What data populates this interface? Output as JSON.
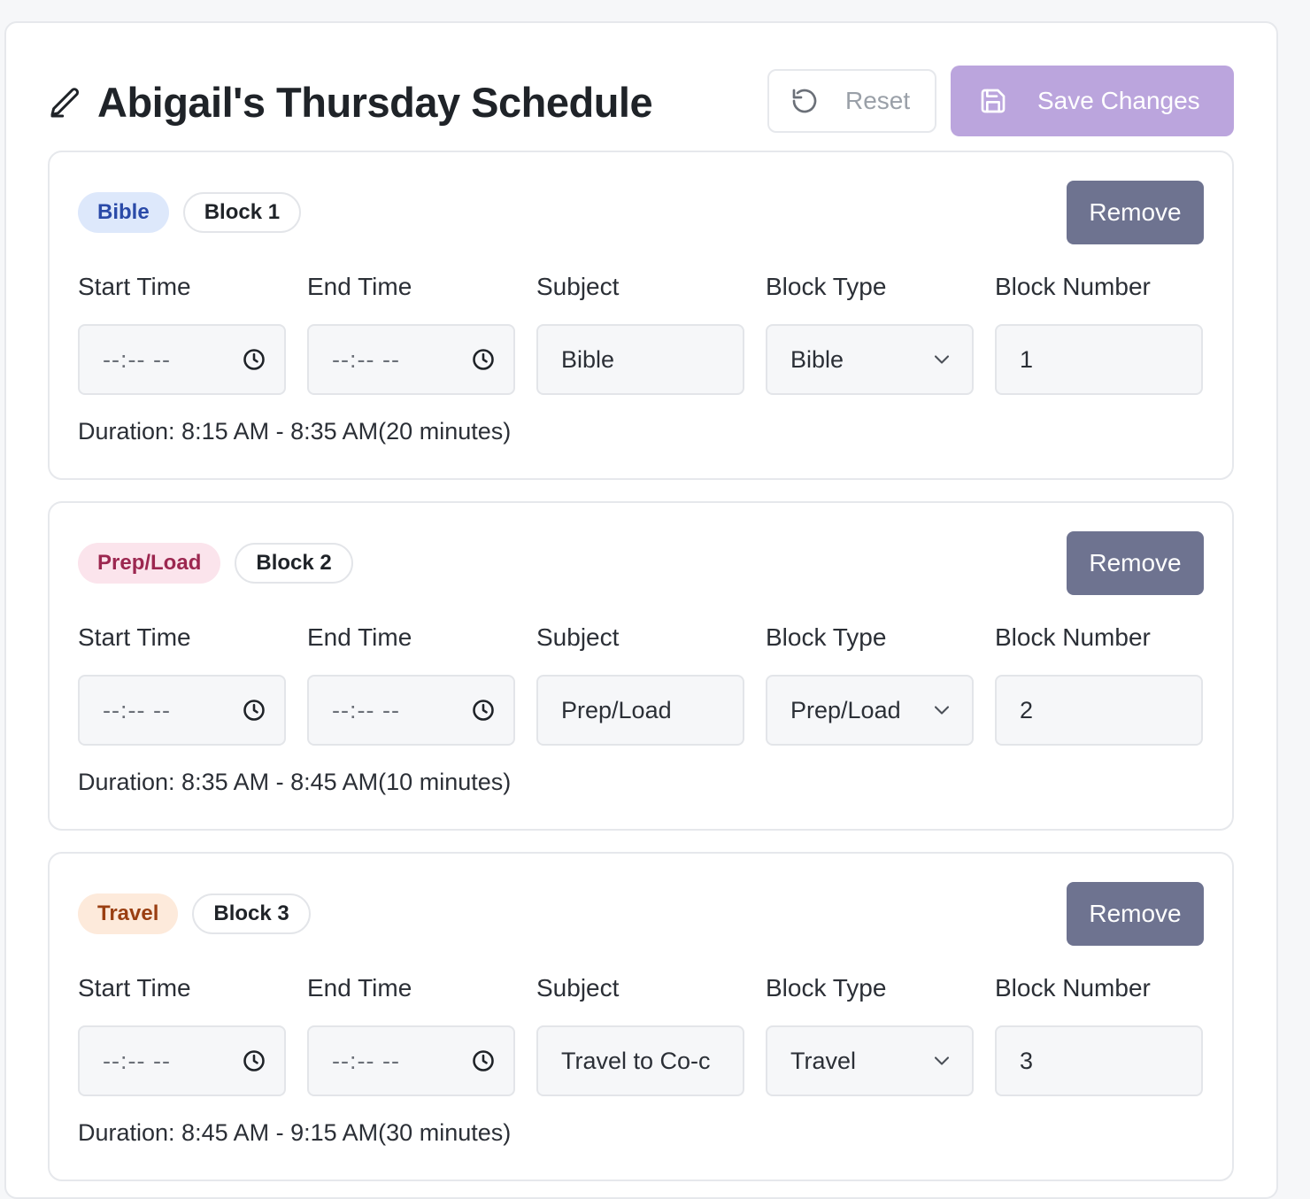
{
  "header": {
    "title": "Abigail's Thursday Schedule",
    "reset_label": "Reset",
    "save_label": "Save Changes"
  },
  "labels": {
    "start_time": "Start Time",
    "end_time": "End Time",
    "subject": "Subject",
    "block_type": "Block Type",
    "block_number": "Block Number",
    "remove": "Remove"
  },
  "blocks": [
    {
      "type_badge": "Bible",
      "block_badge": "Block 1",
      "start_time": "--:-- --",
      "end_time": "--:-- --",
      "subject": "Bible",
      "block_type": "Bible",
      "block_number": "1",
      "duration": "Duration: 8:15 AM - 8:35 AM(20 minutes)",
      "badge_bg": "#dde8fb",
      "badge_fg": "#2a4aa8"
    },
    {
      "type_badge": "Prep/Load",
      "block_badge": "Block 2",
      "start_time": "--:-- --",
      "end_time": "--:-- --",
      "subject": "Prep/Load",
      "block_type": "Prep/Load",
      "block_number": "2",
      "duration": "Duration: 8:35 AM - 8:45 AM(10 minutes)",
      "badge_bg": "#fbe4ec",
      "badge_fg": "#9c2750"
    },
    {
      "type_badge": "Travel",
      "block_badge": "Block 3",
      "start_time": "--:-- --",
      "end_time": "--:-- --",
      "subject": "Travel to Co-c",
      "block_type": "Travel",
      "block_number": "3",
      "duration": "Duration: 8:45 AM - 9:15 AM(30 minutes)",
      "badge_bg": "#fdeadb",
      "badge_fg": "#9a3f12"
    }
  ],
  "colors": {
    "save_button": "#bba5dd",
    "remove_button": "#6e7390"
  }
}
